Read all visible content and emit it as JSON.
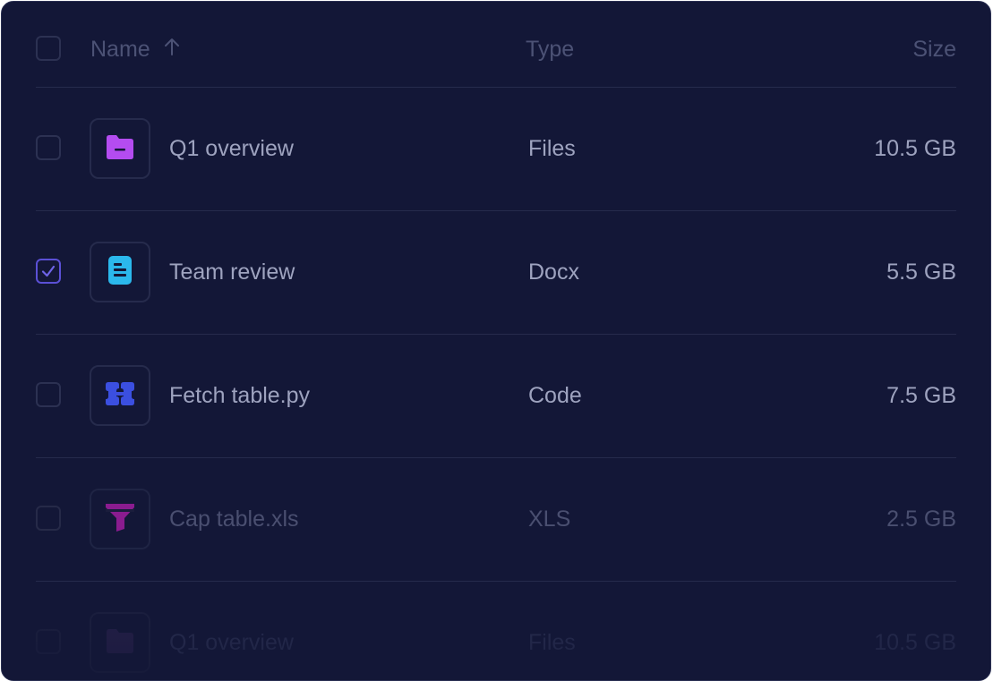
{
  "header": {
    "name_label": "Name",
    "type_label": "Type",
    "size_label": "Size",
    "sort": "ascending"
  },
  "rows": [
    {
      "name": "Q1 overview",
      "type": "Files",
      "size": "10.5 GB",
      "icon": "folder-icon",
      "icon_color": "#b44cf0",
      "checked": false
    },
    {
      "name": "Team review",
      "type": "Docx",
      "size": "5.5 GB",
      "icon": "document-icon",
      "icon_color": "#2bb8ec",
      "checked": true
    },
    {
      "name": "Fetch table.py",
      "type": "Code",
      "size": "7.5 GB",
      "icon": "code-icon",
      "icon_color": "#3b4fe0",
      "checked": false
    },
    {
      "name": "Cap table.xls",
      "type": "XLS",
      "size": "2.5 GB",
      "icon": "funnel-icon",
      "icon_color": "#8a1c8f",
      "checked": false
    },
    {
      "name": "Q1 overview",
      "type": "Files",
      "size": "10.5 GB",
      "icon": "folder-icon",
      "icon_color": "#3a2f66",
      "checked": false
    }
  ],
  "colors": {
    "background": "#131737",
    "divider": "#262b4c",
    "text": "#9ea3bf",
    "muted_text": "#4c5275",
    "checkbox_accent": "#5b50d6"
  }
}
